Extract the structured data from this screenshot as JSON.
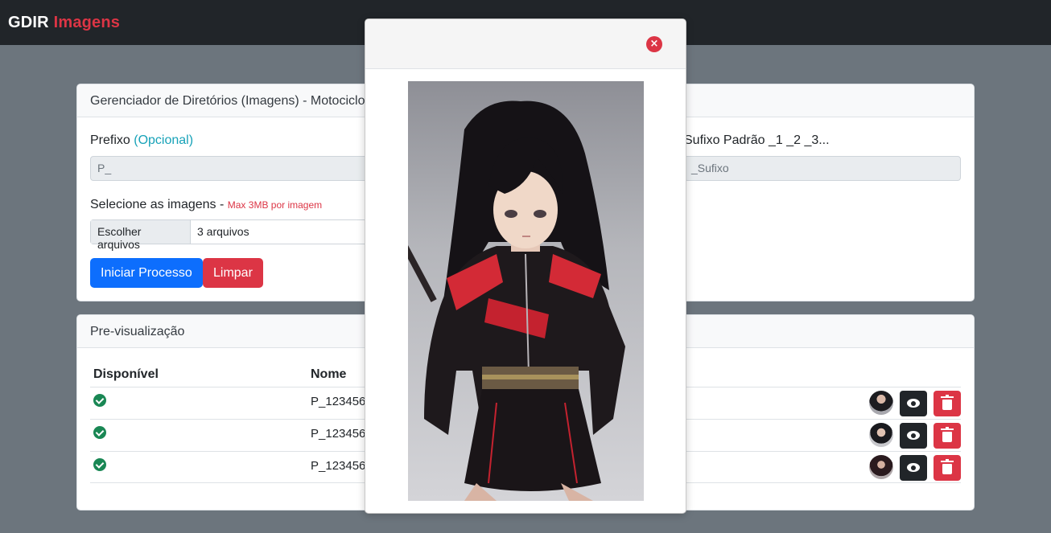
{
  "navbar": {
    "brand_main": "GDIR",
    "brand_accent": "Imagens"
  },
  "form_card": {
    "title": "Gerenciador de Diretórios (Imagens) - Motociclo",
    "prefix_label": "Prefixo",
    "prefix_optional": "(Opcional)",
    "prefix_value": "P_",
    "suffix_label": "Sufixo Padrão _1 _2 _3...",
    "suffix_placeholder": "_Sufixo",
    "images_label": "Selecione as imagens -",
    "images_max": "Max 3MB por imagem",
    "file_button": "Escolher arquivos",
    "file_count": "3 arquivos",
    "start_button": "Iniciar Processo",
    "clear_button": "Limpar"
  },
  "preview_card": {
    "title": "Pre-visualização",
    "columns": [
      "Disponível",
      "Nome"
    ],
    "rows": [
      {
        "available": true,
        "name": "P_123456"
      },
      {
        "available": true,
        "name": "P_123456"
      },
      {
        "available": true,
        "name": "P_123456"
      }
    ]
  },
  "modal": {
    "close_glyph": "×",
    "image_subject": "anime girl in black and red jacket with katana"
  },
  "colors": {
    "navbar": "#212529",
    "accent_red": "#dc3545",
    "primary": "#0d6efd",
    "success": "#198754",
    "info": "#17a2b8",
    "backdrop": "#6c757d"
  },
  "icons": {
    "available": "check-circle-icon",
    "view": "eye-icon",
    "delete": "trash-icon",
    "close": "close-icon"
  }
}
